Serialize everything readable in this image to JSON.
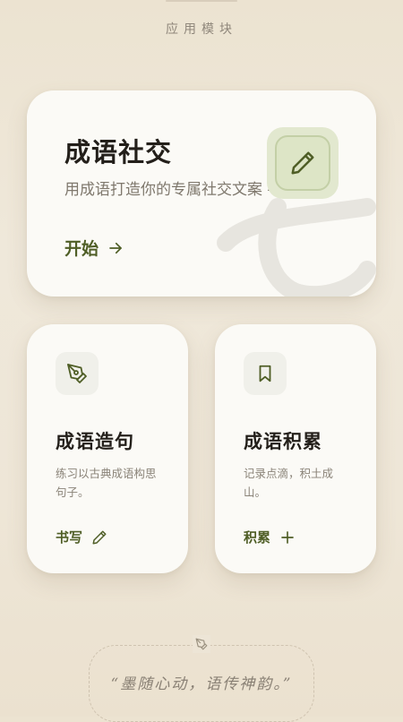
{
  "section": {
    "title": "应用模块"
  },
  "hero": {
    "title": "成语社交",
    "subtitle": "用成语打造你的专属社交文案 -",
    "action_label": "开始",
    "icon": "pencil-icon"
  },
  "cards": [
    {
      "title": "成语造句",
      "description": "练习以古典成语构思句子。",
      "action_label": "书写",
      "icon": "pen-nib-icon",
      "action_icon": "pencil-icon"
    },
    {
      "title": "成语积累",
      "description": "记录点滴，积土成山。",
      "action_label": "积累",
      "icon": "bookmark-icon",
      "action_icon": "plus-icon"
    }
  ],
  "quote": {
    "text": "“墨随心动，语传神韵。”",
    "icon": "pen-nib-icon"
  },
  "colors": {
    "accent": "#4f5e26",
    "background": "#ede5d6",
    "card": "#fbfaf6",
    "icon_bg": "#e2e8cf"
  }
}
